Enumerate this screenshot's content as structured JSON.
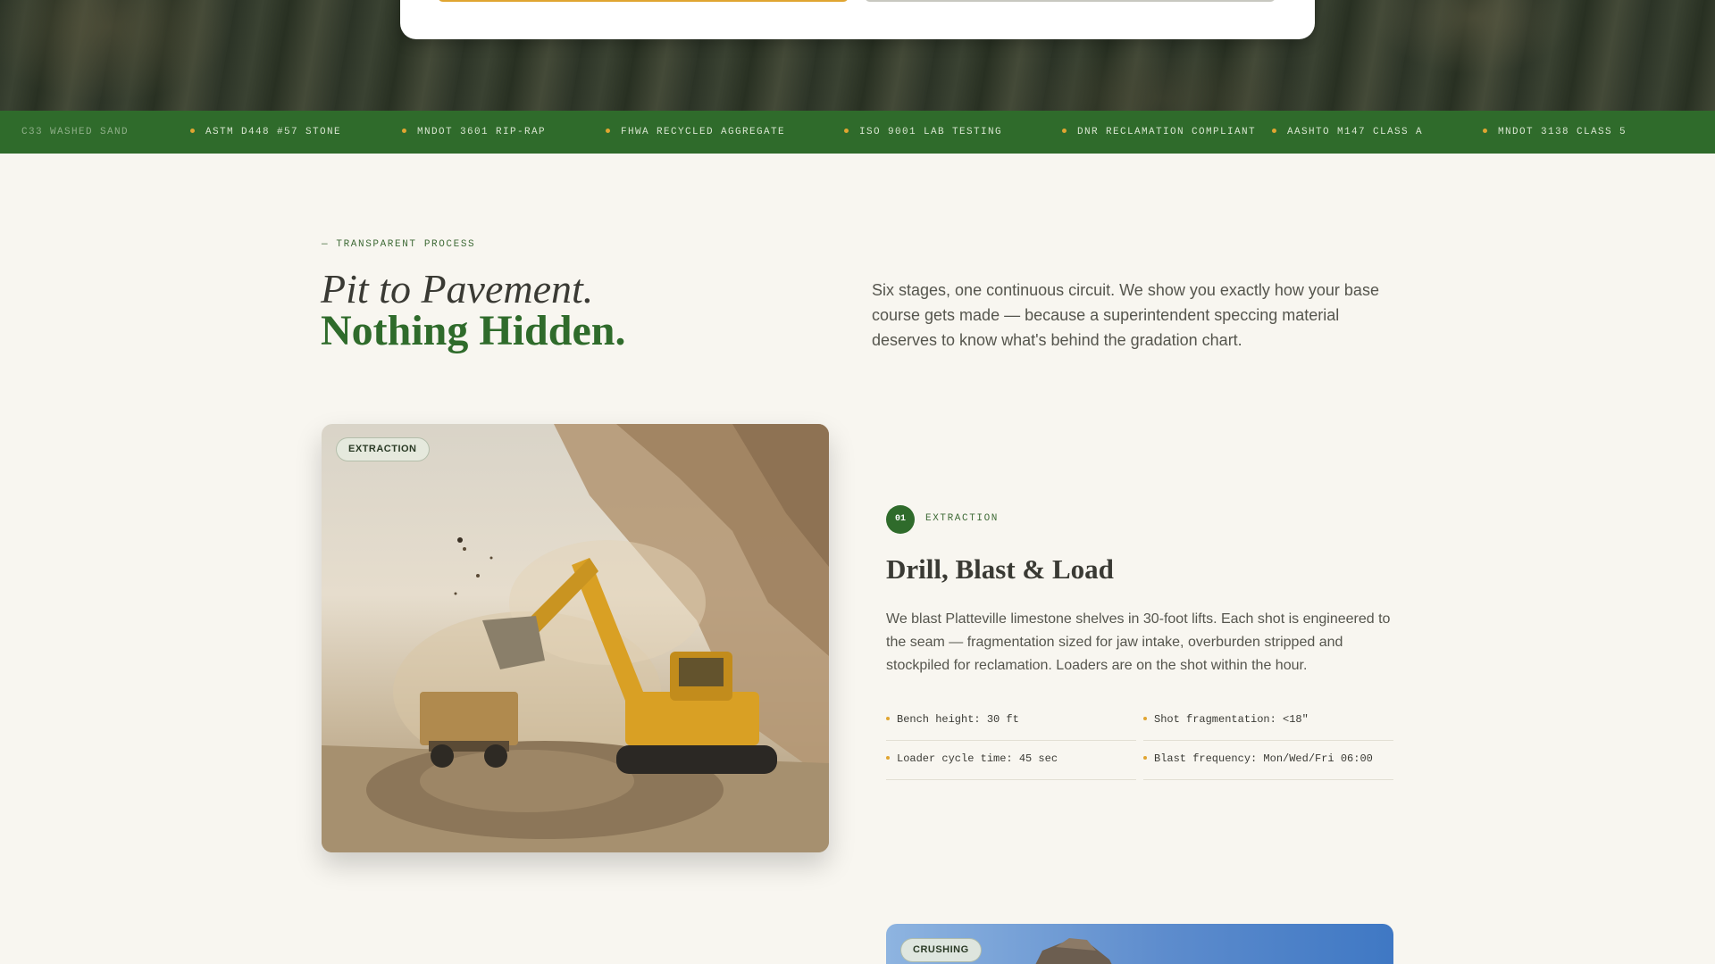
{
  "ticker": {
    "items": [
      "C33 WASHED SAND",
      "ASTM D448 #57 STONE",
      "MNDOT 3601 RIP-RAP",
      "FHWA RECYCLED AGGREGATE",
      "ISO 9001 LAB TESTING",
      "DNR RECLAMATION COMPLIANT",
      "AASHTO M147 CLASS A",
      "MNDOT 3138 CLASS 5"
    ]
  },
  "intro": {
    "eyebrow": "— TRANSPARENT PROCESS",
    "headline_italic": "Pit to Pavement.",
    "headline_bold": "Nothing Hidden.",
    "paragraph": "Six stages, one continuous circuit. We show you exactly how your base course gets made — because a superintendent speccing material deserves to know what's behind the gradation chart."
  },
  "step1": {
    "badge": "EXTRACTION",
    "number": "01",
    "label": "EXTRACTION",
    "title": "Drill, Blast & Load",
    "text": "We blast Platteville limestone shelves in 30-foot lifts. Each shot is engineered to the seam — fragmentation sized for jaw intake, overburden stripped and stockpiled for reclamation. Loaders are on the shot within the hour.",
    "specs": [
      "Bench height: 30 ft",
      "Shot fragmentation: <18\"",
      "Loader cycle time: 45 sec",
      "Blast frequency: Mon/Wed/Fri 06:00"
    ]
  },
  "step2": {
    "badge": "CRUSHING"
  },
  "colors": {
    "brand_green": "#2f6b2b",
    "accent_gold": "#e0a531",
    "background": "#f8f6f0"
  }
}
